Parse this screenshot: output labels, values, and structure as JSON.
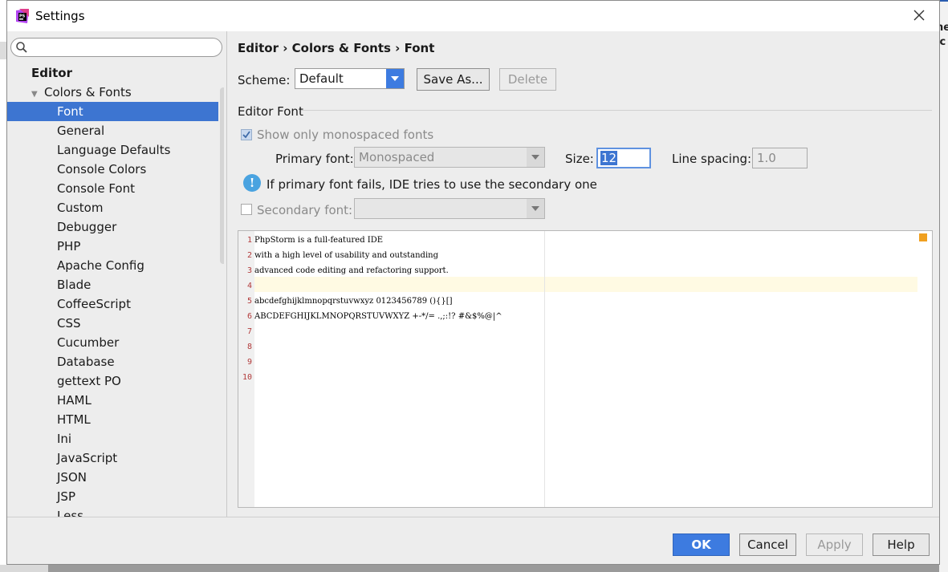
{
  "window": {
    "title": "Settings"
  },
  "background": {
    "fragments": [
      "ne",
      "ic"
    ]
  },
  "sidebar": {
    "search_placeholder": "",
    "items": [
      {
        "label": "Editor",
        "level": 0
      },
      {
        "label": "Colors & Fonts",
        "level": 1,
        "expanded": true
      },
      {
        "label": "Font",
        "level": 2,
        "selected": true
      },
      {
        "label": "General",
        "level": 2
      },
      {
        "label": "Language Defaults",
        "level": 2
      },
      {
        "label": "Console Colors",
        "level": 2
      },
      {
        "label": "Console Font",
        "level": 2
      },
      {
        "label": "Custom",
        "level": 2
      },
      {
        "label": "Debugger",
        "level": 2
      },
      {
        "label": "PHP",
        "level": 2
      },
      {
        "label": "Apache Config",
        "level": 2
      },
      {
        "label": "Blade",
        "level": 2
      },
      {
        "label": "CoffeeScript",
        "level": 2
      },
      {
        "label": "CSS",
        "level": 2
      },
      {
        "label": "Cucumber",
        "level": 2
      },
      {
        "label": "Database",
        "level": 2
      },
      {
        "label": "gettext PO",
        "level": 2
      },
      {
        "label": "HAML",
        "level": 2
      },
      {
        "label": "HTML",
        "level": 2
      },
      {
        "label": "Ini",
        "level": 2
      },
      {
        "label": "JavaScript",
        "level": 2
      },
      {
        "label": "JSON",
        "level": 2
      },
      {
        "label": "JSP",
        "level": 2
      },
      {
        "label": "Less",
        "level": 2
      }
    ]
  },
  "content": {
    "breadcrumb": "Editor › Colors & Fonts › Font",
    "scheme": {
      "label": "Scheme:",
      "value": "Default",
      "save_as_label": "Save As...",
      "delete_label": "Delete"
    },
    "editor_font": {
      "group_label": "Editor Font",
      "show_mono_label": "Show only monospaced fonts",
      "show_mono_checked": true,
      "primary_font_label": "Primary font:",
      "primary_font_value": "Monospaced",
      "size_label": "Size:",
      "size_value": "12",
      "line_spacing_label": "Line spacing:",
      "line_spacing_value": "1.0",
      "info_text": "If primary font fails, IDE tries to use the secondary one",
      "secondary_font_label": "Secondary font:",
      "secondary_font_checked": false,
      "secondary_font_value": ""
    },
    "preview": {
      "lines": [
        {
          "n": "1",
          "text": "PhpStorm is a full-featured IDE"
        },
        {
          "n": "2",
          "text": "with a high level of usability and outstanding"
        },
        {
          "n": "3",
          "text": "advanced code editing and refactoring support."
        },
        {
          "n": "4",
          "text": ""
        },
        {
          "n": "5",
          "text": "abcdefghijklmnopqrstuvwxyz 0123456789 (){}[]"
        },
        {
          "n": "6",
          "text": "ABCDEFGHIJKLMNOPQRSTUVWXYZ +-*/= .,;:!? #&$%@|^"
        },
        {
          "n": "7",
          "text": ""
        },
        {
          "n": "8",
          "text": ""
        },
        {
          "n": "9",
          "text": ""
        },
        {
          "n": "10",
          "text": ""
        }
      ]
    }
  },
  "footer": {
    "ok_label": "OK",
    "cancel_label": "Cancel",
    "apply_label": "Apply",
    "help_label": "Help"
  },
  "colors": {
    "accent": "#3d75d1",
    "primary_button": "#3d7be0",
    "current_line": "#fffae3",
    "marker": "#f0a020"
  }
}
